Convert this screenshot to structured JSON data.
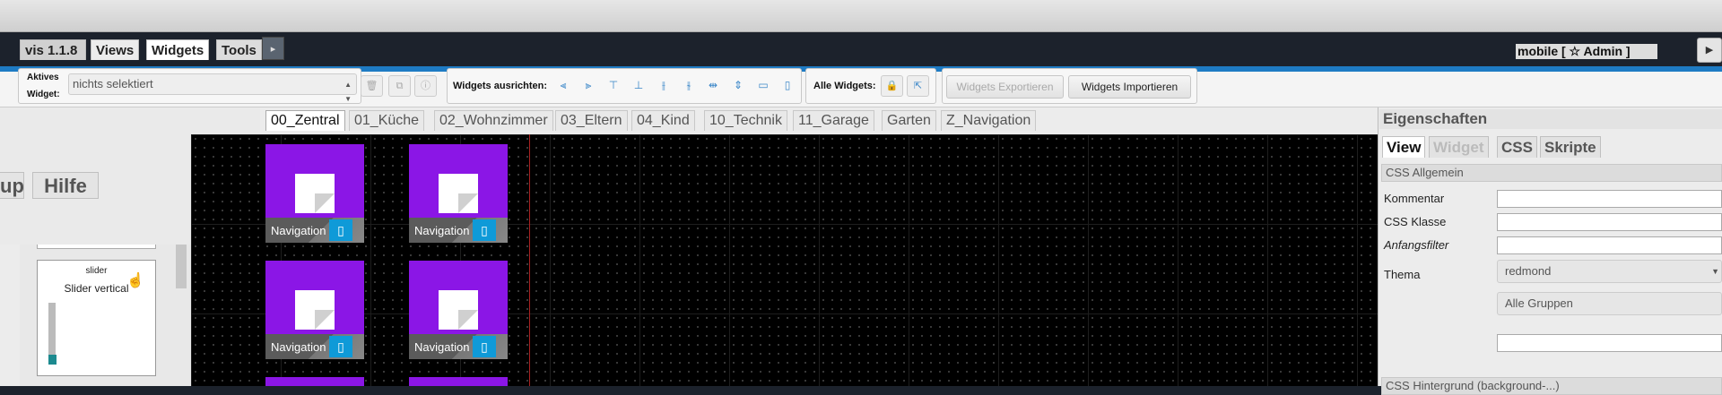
{
  "menubar": {
    "version": "vis 1.1.8",
    "views": "Views",
    "widgets": "Widgets",
    "tools": "Tools",
    "small_button": "▸",
    "user": "mobile [ ☆ Admin ]",
    "play": "▶"
  },
  "toolbar": {
    "active_widget_label_1": "Aktives",
    "active_widget_label_2": "Widget:",
    "active_widget_value": "nichts selektiert",
    "align_label": "Widgets ausrichten:",
    "all_widgets_label": "Alle Widgets:",
    "export_label": "Widgets Exportieren",
    "import_label": "Widgets Importieren"
  },
  "overlay": {
    "setup_tab": "up",
    "help_tab": "Hilfe"
  },
  "sidebar": {
    "card_title": "slider",
    "card_name": "Slider vertical",
    "slider_value": 0.1
  },
  "page_tabs": [
    "00_Zentral",
    "01_Küche",
    "02_Wohnzimmer",
    "03_Eltern",
    "04_Kind",
    "10_Technik",
    "11_Garage",
    "Garten",
    "Z_Navigation"
  ],
  "active_page_tab": "00_Zentral",
  "tiles": {
    "label": "Navigation"
  },
  "properties": {
    "title": "Eigenschaften",
    "tabs": [
      "View",
      "Widget",
      "CSS",
      "Skripte"
    ],
    "section_general": "CSS Allgemein",
    "comment_label": "Kommentar",
    "css_class_label": "CSS Klasse",
    "start_filter_label": "Anfangsfilter",
    "theme_label": "Thema",
    "theme_value": "redmond",
    "groups_value": "Alle Gruppen",
    "section_background": "CSS Hintergrund (background-...)"
  },
  "colors": {
    "accent": "#1e7bc4",
    "tile": "#8b16e6",
    "tile_icon": "#0f9ad8"
  }
}
